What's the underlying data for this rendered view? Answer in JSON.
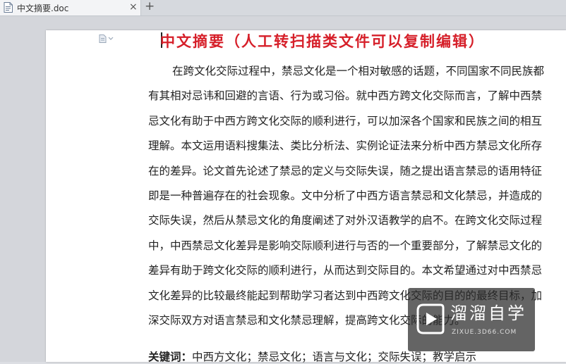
{
  "tab": {
    "title": "中文摘要.doc",
    "close": "×",
    "new_tab": "+"
  },
  "document": {
    "title": "中文摘要（人工转扫描类文件可以复制编辑）",
    "lines": [
      "在跨文化交际过程中，禁忌文化是一个相对敏感的话题，不同国家不同民族都",
      "有其相对忌讳和回避的言语、行为或习俗。就中西方跨文化交际而言，了解中西禁",
      "忌文化有助于中西方跨文化交际的顺利进行，可以加深各个国家和民族之间的相互",
      "理解。本文运用语料搜集法、类比分析法、实例论证法来分析中西方禁忌文化所存",
      "在的差异。论文首先论述了禁忌的定义与交际失误，随之提出语言禁忌的语用特征",
      "即是一种普遍存在的社会现象。文中分析了中西方语言禁忌和文化禁忌，并造成的",
      "交际失误，然后从禁忌文化的角度阐述了对外汉语教学的启不。在跨文化交际过程",
      "中，中西禁忌文化差异是影响交际顺利进行与否的一个重要部分，了解禁忌文化的",
      "差异有助于跨文化交际的顺利进行，从而达到交际目的。本文希望通过对中西禁忌",
      "文化差异的比较最终能起到帮助学习者达到中西跨文化交际的目的的最终目标，加",
      "深交际双方对语言禁忌和文化禁忌理解，提高跨文化交际的能力。"
    ],
    "keywords_label": "关键词：",
    "keywords_text": "中西方文化；禁忌文化；语言与文化；交际失误；教学启示"
  },
  "watermark": {
    "name": "溜溜自学",
    "url": "ZIXUE.3D66.COM"
  }
}
